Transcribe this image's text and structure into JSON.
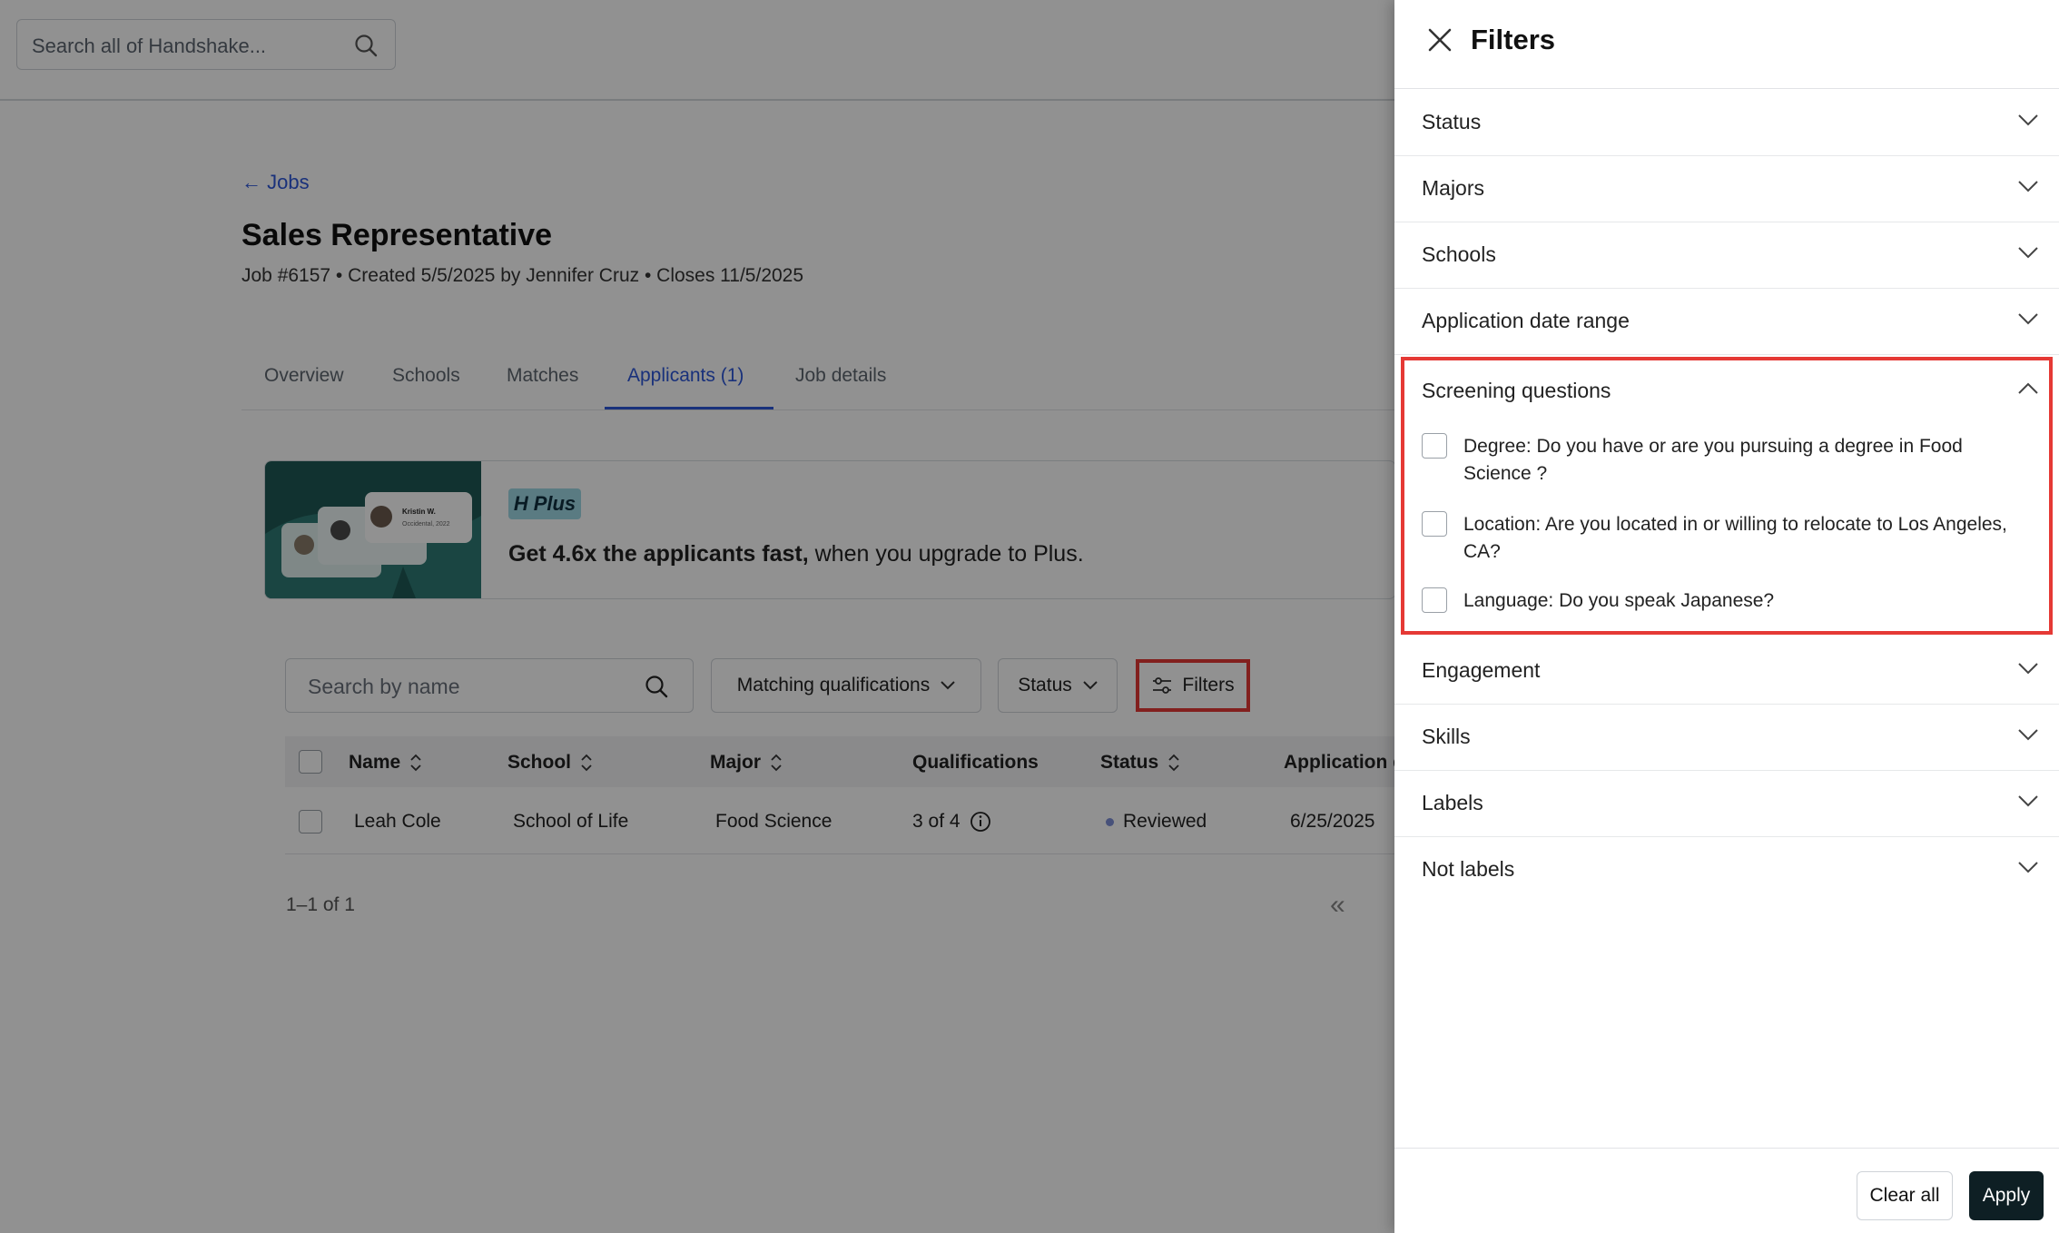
{
  "header": {
    "search_placeholder": "Search all of Handshake..."
  },
  "job": {
    "back_label": "← Jobs",
    "title": "Sales Representative",
    "meta": "Job #6157  •  Created 5/5/2025 by Jennifer Cruz  •  Closes 11/5/2025"
  },
  "tabs": [
    {
      "label": "Overview"
    },
    {
      "label": "Schools"
    },
    {
      "label": "Matches"
    },
    {
      "label": "Applicants (1)",
      "active": true
    },
    {
      "label": "Job details"
    }
  ],
  "promo": {
    "badge_h": "H",
    "badge_plus": "Plus",
    "card_name": "Kristin W.",
    "card_sub": "Occidental, 2022",
    "text_bold": "Get 4.6x the applicants fast,",
    "text_rest": " when you upgrade to Plus."
  },
  "toolbar": {
    "search_placeholder": "Search by name",
    "matching_label": "Matching qualifications",
    "status_label": "Status",
    "filters_label": "Filters"
  },
  "table": {
    "columns": [
      "Name",
      "School",
      "Major",
      "Qualifications",
      "Status",
      "Application d"
    ],
    "rows": [
      {
        "name": "Leah Cole",
        "school": "School of Life",
        "major": "Food Science",
        "qualifications": "3 of 4",
        "status": "Reviewed",
        "date": "6/25/2025"
      }
    ],
    "pagination": "1–1 of 1"
  },
  "panel": {
    "title": "Filters",
    "sections": [
      {
        "label": "Status"
      },
      {
        "label": "Majors"
      },
      {
        "label": "Schools"
      },
      {
        "label": "Application date range"
      }
    ],
    "screening": {
      "label": "Screening questions",
      "questions": [
        "Degree: Do you have or are you pursuing a degree in Food Science ?",
        "Location: Are you located in or willing to relocate to Los Angeles, CA?",
        "Language: Do you speak Japanese?"
      ]
    },
    "sections_after": [
      {
        "label": "Engagement"
      },
      {
        "label": "Skills"
      },
      {
        "label": "Labels"
      },
      {
        "label": "Not labels"
      }
    ],
    "clear_label": "Clear all",
    "apply_label": "Apply"
  },
  "colors": {
    "accent": "#2d56d8",
    "highlight": "#e53935",
    "apply_bg": "#0e1f24",
    "promo_bg": "#1f5855",
    "plus_badge": "#9fd9e5"
  }
}
